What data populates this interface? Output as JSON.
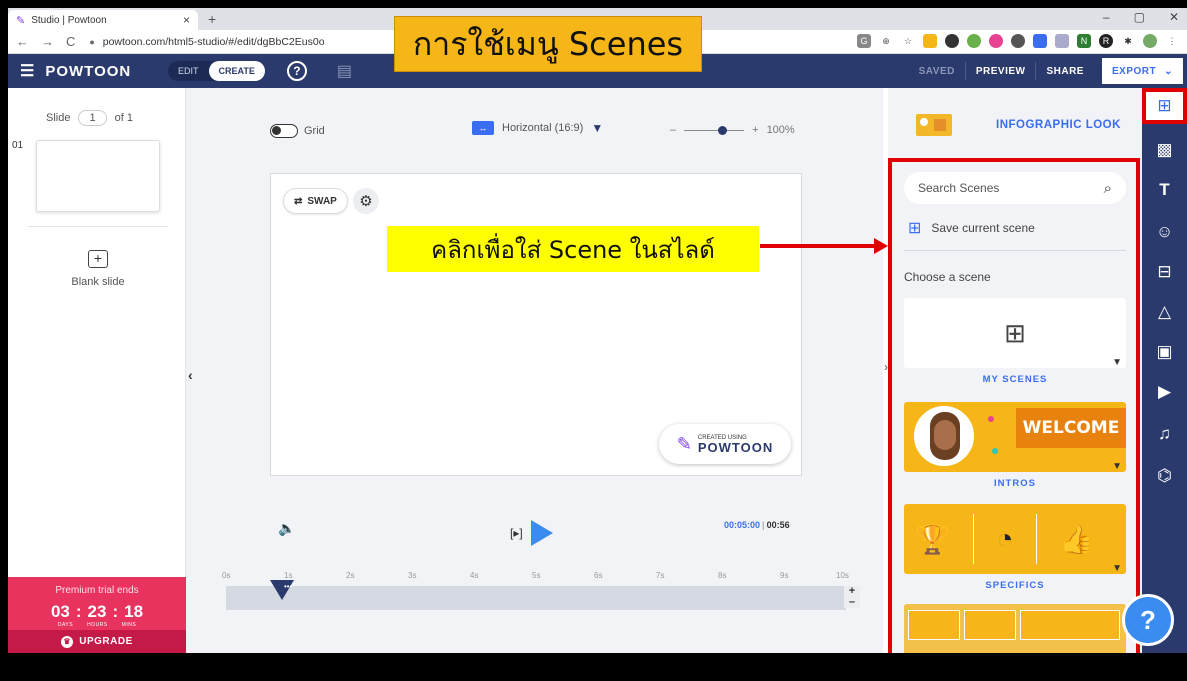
{
  "browser": {
    "tab_title": "Studio | Powtoon",
    "url": "powtoon.com/html5-studio/#/edit/dgBbC2Eus0o",
    "window_controls": [
      "–",
      "▢",
      "✕"
    ]
  },
  "banner": {
    "text": "การใช้เมนู Scenes"
  },
  "toolbar": {
    "logo": "POWTOON",
    "mode_edit": "EDIT",
    "mode_create": "CREATE",
    "help": "?",
    "saved": "SAVED",
    "preview": "PREVIEW",
    "share": "SHARE",
    "export": "EXPORT"
  },
  "slides_panel": {
    "slide_label": "Slide",
    "slide_current": "1",
    "slide_of": "of 1",
    "slide_index": "01",
    "blank_slide": "Blank slide"
  },
  "premium": {
    "title": "Premium trial ends",
    "days": "03",
    "hours": "23",
    "mins": "18",
    "days_label": "DAYS",
    "hours_label": "HOURS",
    "mins_label": "MINS",
    "upgrade": "UPGRADE"
  },
  "canvas": {
    "grid_label": "Grid",
    "orientation": "Horizontal (16:9)",
    "zoom_minus": "–",
    "zoom_plus": "+",
    "zoom_value": "100%",
    "swap": "SWAP",
    "watermark_small": "CREATED USING",
    "watermark_brand": "POWTOON",
    "instruction": "คลิกเพื่อใส่ Scene ในสไลด์",
    "time_current": "00:05:00",
    "time_total": "00:56",
    "ruler": [
      "0s",
      "1s",
      "2s",
      "3s",
      "4s",
      "5s",
      "6s",
      "7s",
      "8s",
      "9s",
      "10s"
    ]
  },
  "scenes_panel": {
    "look_name": "INFOGRAPHIC LOOK",
    "search_placeholder": "Search Scenes",
    "save_current": "Save current scene",
    "choose": "Choose a scene",
    "my_scenes": "MY SCENES",
    "intros": "INTROS",
    "intro_banner": "WELCOME",
    "specifics": "SPECIFICS"
  },
  "colors": {
    "toolbar_bg": "#2b3a6c",
    "accent_blue": "#3a6df0",
    "highlight_red": "#e00000",
    "banner_orange": "#f6b618",
    "instruction_yellow": "#ffff00",
    "premium_pink": "#e8335f"
  }
}
